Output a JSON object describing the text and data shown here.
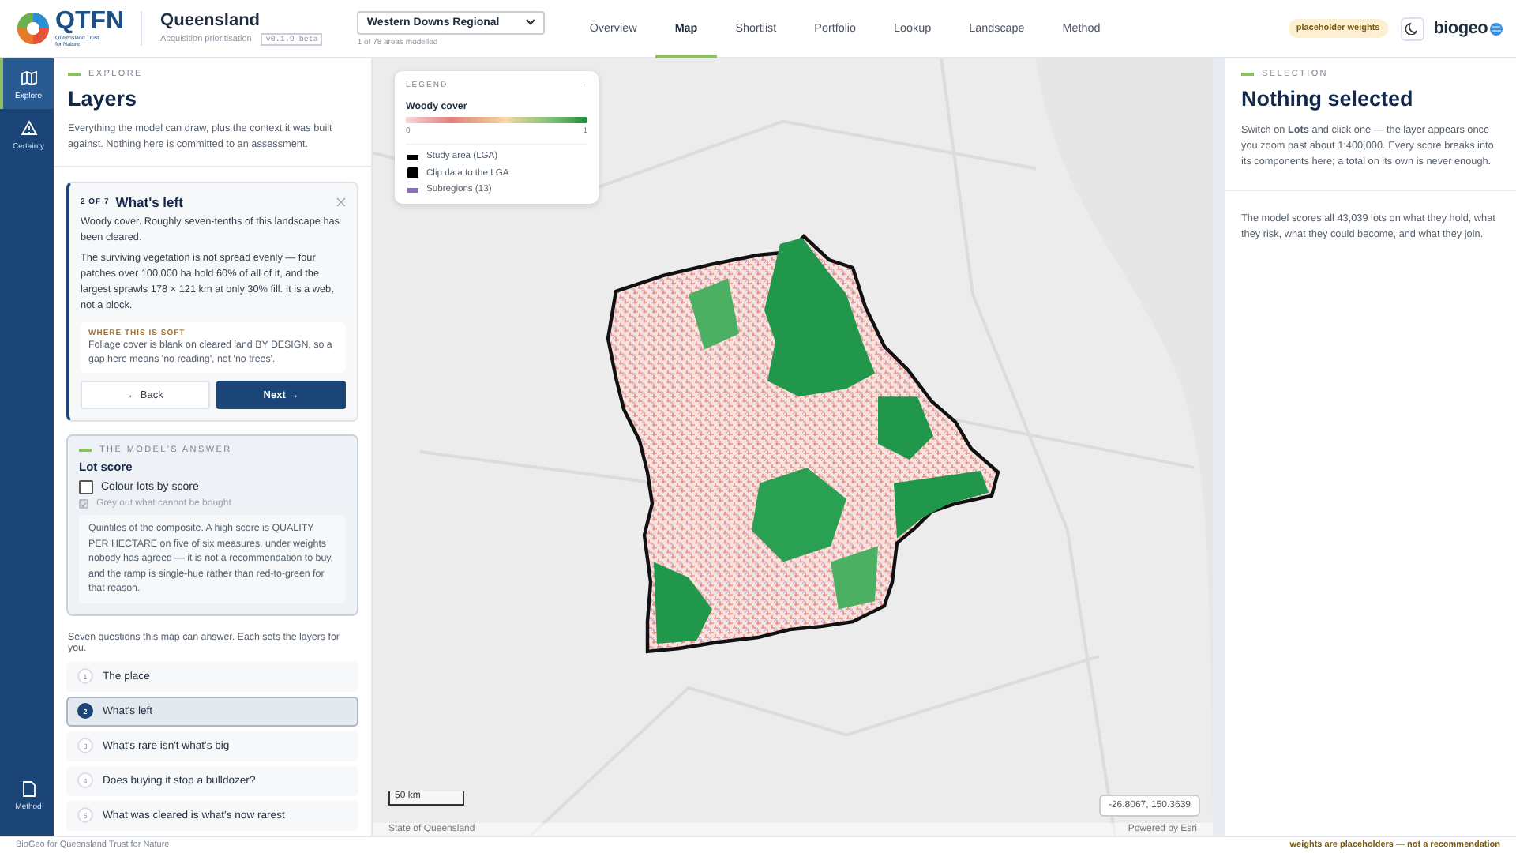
{
  "header": {
    "logo": "QTFN",
    "logo_sub": "Queensland Trust for Nature",
    "title": "Queensland",
    "subtitle": "Acquisition prioritisation",
    "version": "v0.1.9 beta",
    "area_select": {
      "value": "Western Downs Regional"
    },
    "area_note": "1 of 78 areas modelled",
    "nav": [
      {
        "label": "Overview",
        "selected": false
      },
      {
        "label": "Map",
        "selected": true
      },
      {
        "label": "Shortlist",
        "selected": false
      },
      {
        "label": "Portfolio",
        "selected": false
      },
      {
        "label": "Lookup",
        "selected": false
      },
      {
        "label": "Landscape",
        "selected": false
      },
      {
        "label": "Method",
        "selected": false
      }
    ],
    "badge": "placeholder weights",
    "brand": "biogeo"
  },
  "rail": [
    {
      "label": "Explore",
      "selected": true
    },
    {
      "label": "Certainty",
      "selected": false
    },
    {
      "label": "Method",
      "selected": false
    }
  ],
  "explore": {
    "eyebrow": "EXPLORE",
    "title": "Layers",
    "intro": "Everything the model can draw, plus the context it was built against. Nothing here is committed to an assessment."
  },
  "step_card": {
    "step": "2 OF 7",
    "title": "What's left",
    "paragraphs": [
      "Woody cover. Roughly seven-tenths of this landscape has been cleared.",
      "The surviving vegetation is not spread evenly — four patches over 100,000 ha hold 60% of all of it, and the largest sprawls 178 × 121 km at only 30% fill. It is a web, not a block."
    ],
    "soft_note": {
      "heading": "WHERE THIS IS SOFT",
      "text": "Foliage cover is blank on cleared land BY DESIGN, so a gap here means 'no reading', not 'no trees'."
    },
    "buttons": [
      "← Back",
      "Next →"
    ]
  },
  "answer_card": {
    "eyebrow": "THE MODEL'S ANSWER",
    "title": "Lot score",
    "options": [
      {
        "label": "Colour lots by score",
        "checked": false,
        "disabled": false
      },
      {
        "label": "Grey out what cannot be bought",
        "checked": true,
        "disabled": true
      }
    ],
    "note": "Quintiles of the composite. A high score is QUALITY PER HECTARE on five of six measures, under weights nobody has agreed — it is not a recommendation to buy, and the ramp is single-hue rather than red-to-green for that reason."
  },
  "questions_intro": "Seven questions this map can answer. Each sets the layers for you.",
  "questions": [
    {
      "number": "1",
      "label": "The place",
      "selected": false
    },
    {
      "number": "2",
      "label": "What's left",
      "selected": true
    },
    {
      "number": "3",
      "label": "What's rare isn't what's big",
      "selected": false
    },
    {
      "number": "4",
      "label": "Does buying it stop a bulldozer?",
      "selected": false
    },
    {
      "number": "5",
      "label": "What was cleared is what's now rarest",
      "selected": false
    }
  ],
  "legend": {
    "heading": "LEGEND",
    "collapse": "-",
    "layer": "Woody cover",
    "min": "0",
    "max": "1",
    "items": [
      {
        "kind": "line",
        "label": "Study area (LGA)",
        "color": "#000000"
      },
      {
        "kind": "square",
        "label": "Clip data to the LGA",
        "color": "#000000"
      },
      {
        "kind": "line",
        "label": "Subregions (13)",
        "color": "#8a6fb8"
      }
    ]
  },
  "map": {
    "scale": "50 km",
    "coordinates": "-26.8067, 150.3639",
    "attribution_left": "State of Queensland",
    "attribution_right": "Powered by Esri"
  },
  "selection": {
    "eyebrow": "SELECTION",
    "title": "Nothing selected",
    "hint": "Switch on **Lots** and click one — the layer appears once you zoom past about 1:400,000. Every score breaks into its components here; a total on its own is never enough.",
    "summary": "The model scores all 43,039 lots on what they hold, what they risk, what they could become, and what they join."
  },
  "footer": {
    "left": "BioGeo for Queensland Trust for Nature",
    "right": "weights are placeholders — not a recommendation"
  }
}
